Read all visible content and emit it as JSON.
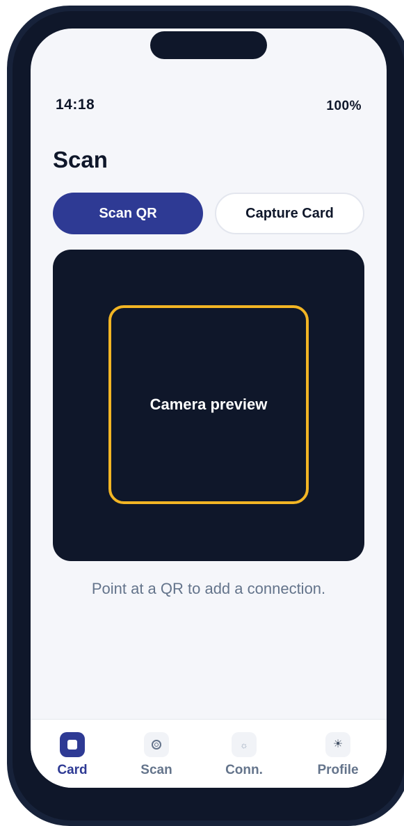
{
  "status_bar": {
    "time": "14:18",
    "battery": "100%"
  },
  "page": {
    "title": "Scan"
  },
  "segmented": {
    "scan_qr_label": "Scan QR",
    "capture_card_label": "Capture Card",
    "selected": "Scan QR"
  },
  "camera": {
    "preview_label": "Camera preview",
    "frame_color": "#f2b524"
  },
  "hint": {
    "text": "Point at a QR to add a connection."
  },
  "tabbar": {
    "items": [
      {
        "label": "Card",
        "icon": "card-icon",
        "active": true
      },
      {
        "label": "Scan",
        "icon": "scan-icon",
        "active": false
      },
      {
        "label": "Conn.",
        "icon": "connections-icon",
        "active": false
      },
      {
        "label": "Profile",
        "icon": "profile-icon",
        "active": false
      }
    ]
  },
  "colors": {
    "accent": "#2e3a94",
    "dark": "#0f172a",
    "background": "#f5f6fa",
    "muted_text": "#64748b"
  }
}
